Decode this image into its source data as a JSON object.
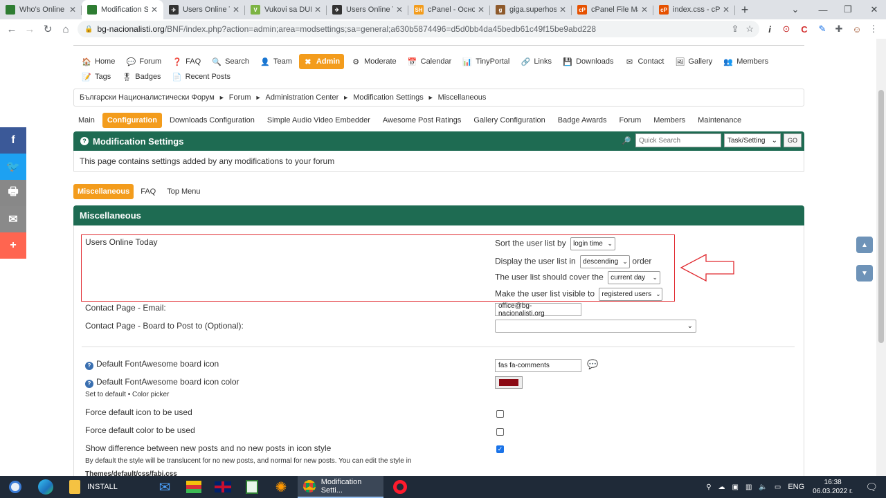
{
  "browser": {
    "tabs": [
      {
        "title": "Who's Online",
        "fav_color": "#2e7d32",
        "fav_text": ""
      },
      {
        "title": "Modification Se",
        "fav_color": "#2e7d32",
        "fav_text": "",
        "active": true
      },
      {
        "title": "Users Online To",
        "fav_color": "#333333",
        "fav_text": "✈"
      },
      {
        "title": "Vukovi sa DUN",
        "fav_color": "#7cb342",
        "fav_text": "V"
      },
      {
        "title": "Users Online To",
        "fav_color": "#333333",
        "fav_text": "✈"
      },
      {
        "title": "cPanel - Основ",
        "fav_color": "#f39c1c",
        "fav_text": "SH"
      },
      {
        "title": "giga.superhosti",
        "fav_color": "#8e5a2c",
        "fav_text": "g"
      },
      {
        "title": "cPanel File Man",
        "fav_color": "#e65100",
        "fav_text": "cP"
      },
      {
        "title": "index.css - cPa",
        "fav_color": "#e65100",
        "fav_text": "cP"
      }
    ],
    "url_host": "bg-nacionalisti.org",
    "url_path": "/BNF/index.php?action=admin;area=modsettings;sa=general;a630b5874496=d5d0bb4da45bedb61c49f15be9abd228"
  },
  "menu": {
    "row1": [
      {
        "label": "Home",
        "icon": "🏠"
      },
      {
        "label": "Forum",
        "icon": "💬"
      },
      {
        "label": "FAQ",
        "icon": "❓"
      },
      {
        "label": "Search",
        "icon": "🔍"
      },
      {
        "label": "Team",
        "icon": "👤"
      },
      {
        "label": "Admin",
        "icon": "✖",
        "active": true
      },
      {
        "label": "Moderate",
        "icon": "⚙"
      },
      {
        "label": "Calendar",
        "icon": "📅"
      },
      {
        "label": "TinyPortal",
        "icon": "📊"
      },
      {
        "label": "Links",
        "icon": "🔗"
      },
      {
        "label": "Downloads",
        "icon": "💾"
      },
      {
        "label": "Contact",
        "icon": "✉"
      },
      {
        "label": "Gallery",
        "icon": "🖼"
      },
      {
        "label": "Members",
        "icon": "👥"
      }
    ],
    "row2": [
      {
        "label": "Tags",
        "icon": "📝"
      },
      {
        "label": "Badges",
        "icon": "🎖"
      },
      {
        "label": "Recent Posts",
        "icon": "📄"
      }
    ]
  },
  "breadcrumb": [
    "Български Националистически Форум",
    "Forum",
    "Administration Center",
    "Modification Settings",
    "Miscellaneous"
  ],
  "subnav": [
    {
      "label": "Main"
    },
    {
      "label": "Configuration",
      "active": true
    },
    {
      "label": "Downloads Configuration"
    },
    {
      "label": "Simple Audio Video Embedder"
    },
    {
      "label": "Awesome Post Ratings"
    },
    {
      "label": "Gallery Configuration"
    },
    {
      "label": "Badge Awards"
    },
    {
      "label": "Forum"
    },
    {
      "label": "Members"
    },
    {
      "label": "Maintenance"
    }
  ],
  "modsettings": {
    "title": "Modification Settings",
    "quick_search_placeholder": "Quick Search",
    "quick_search_scope": "Task/Setting",
    "go_label": "GO",
    "description": "This page contains settings added by any modifications to your forum"
  },
  "tabs2": [
    {
      "label": "Miscellaneous",
      "active": true
    },
    {
      "label": "FAQ"
    },
    {
      "label": "Top Menu"
    }
  ],
  "section": {
    "title": "Miscellaneous",
    "users_online_today": "Users Online Today",
    "sort_label": "Sort the user list by",
    "sort_value": "login time",
    "display_label": "Display the user list in",
    "display_value": "descending",
    "display_suffix": "order",
    "cover_label": "The user list should cover the",
    "cover_value": "current day",
    "visible_label": "Make the user list visible to",
    "visible_value": "registered users",
    "contact_email_label": "Contact Page - Email:",
    "contact_email_value": "office@bg-nacionalisti.org",
    "contact_board_label": "Contact Page - Board to Post to (Optional):",
    "fa_icon_label": "Default FontAwesome board icon",
    "fa_icon_value": "fas fa-comments",
    "fa_color_label": "Default FontAwesome board icon color",
    "fa_color_value": "#8b0a14",
    "fa_color_links": "Set to default • Color picker",
    "force_icon_label": "Force default icon to be used",
    "force_icon_checked": false,
    "force_color_label": "Force default color to be used",
    "force_color_checked": false,
    "show_diff_label": "Show difference between new posts and no new posts in icon style",
    "show_diff_checked": true,
    "show_diff_help": "By default the style will be translucent for no new posts, and normal for new posts. You can edit the style in",
    "show_diff_path": "Themes/default/css/fabi.css"
  },
  "share": [
    {
      "icon": "f",
      "color": "#3b5998"
    },
    {
      "icon": "🐦",
      "color": "#1da1f2"
    },
    {
      "icon": "🖶",
      "color": "#888888"
    },
    {
      "icon": "✉",
      "color": "#8a8a8a"
    },
    {
      "icon": "+",
      "color": "#ff6550"
    }
  ],
  "taskbar": {
    "install_label": "INSTALL",
    "active_label": "Modification Setti...",
    "lang": "ENG",
    "time": "16:38",
    "date": "06.03.2022 г."
  },
  "colors": {
    "accent_orange": "#f39c1c",
    "header_green": "#1e6b52",
    "annotation_red": "#e0282e"
  }
}
